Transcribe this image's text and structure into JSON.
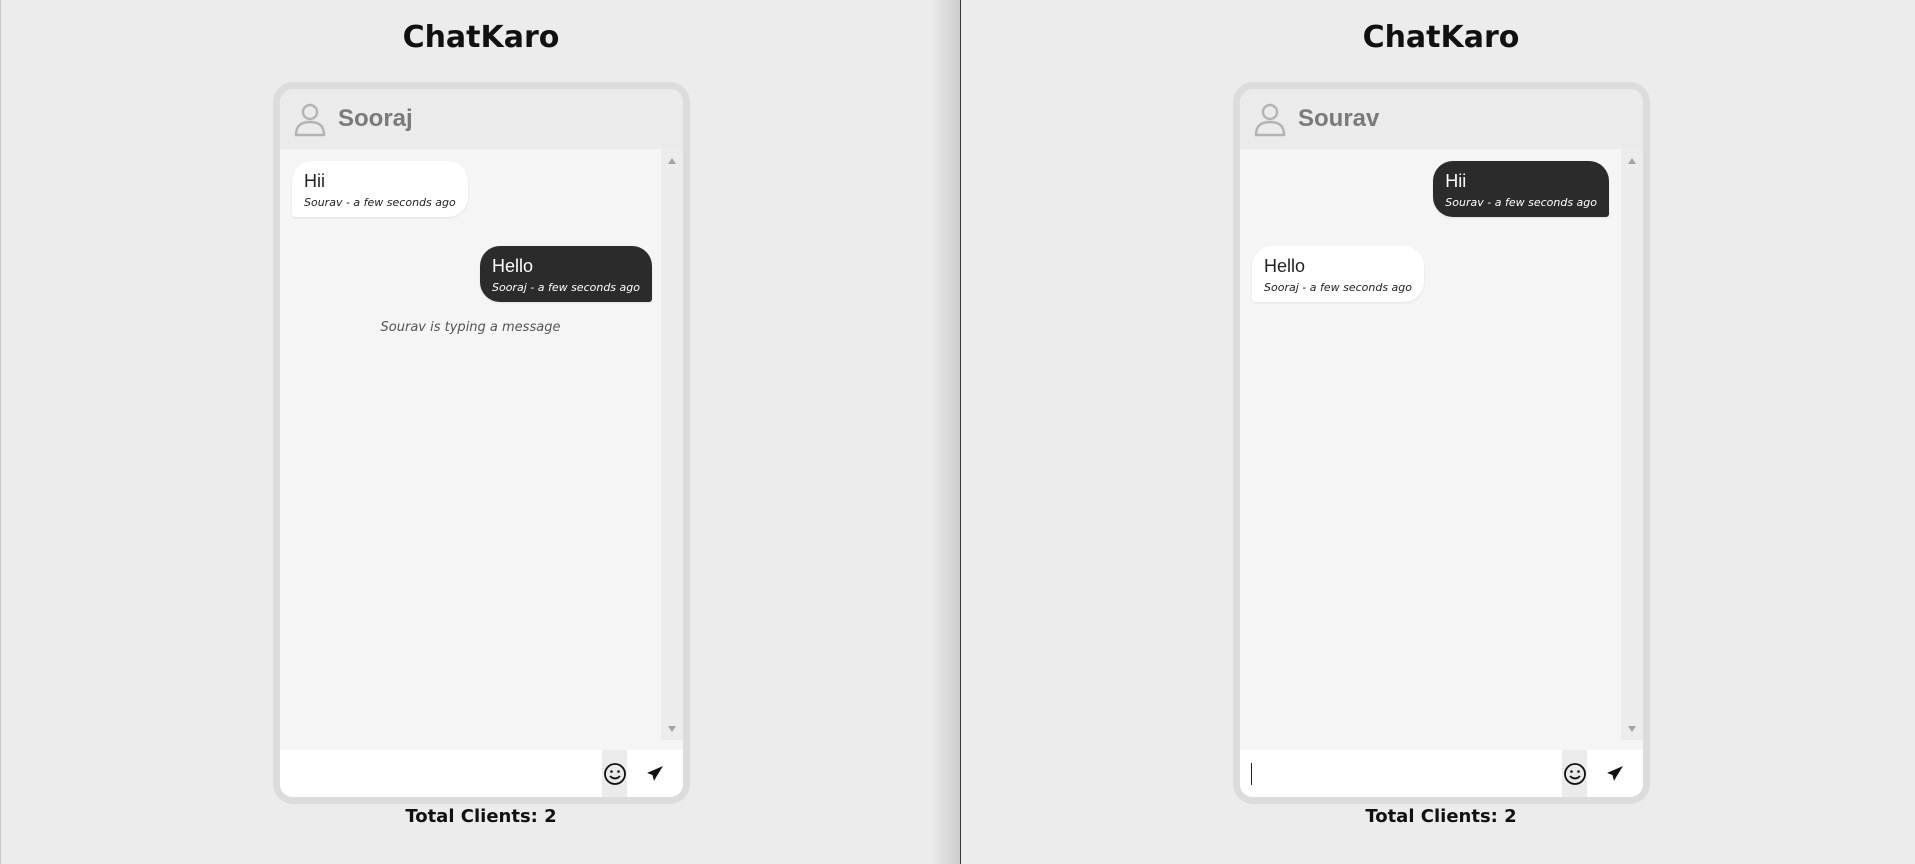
{
  "left": {
    "app_title": "ChatKaro",
    "header_name": "Sooraj",
    "messages": [
      {
        "text": "Hii",
        "meta": "Sourav - a few seconds ago",
        "side": "in"
      },
      {
        "text": "Hello",
        "meta": "Sooraj - a few seconds ago",
        "side": "out"
      }
    ],
    "typing": "Sourav is typing a message",
    "input_value": "",
    "total_clients": "Total Clients: 2"
  },
  "right": {
    "app_title": "ChatKaro",
    "header_name": "Sourav",
    "messages": [
      {
        "text": "Hii",
        "meta": "Sourav - a few seconds ago",
        "side": "out"
      },
      {
        "text": "Hello",
        "meta": "Sooraj - a few seconds ago",
        "side": "in"
      }
    ],
    "input_value": "",
    "total_clients": "Total Clients: 2"
  },
  "icons": {
    "avatar": "user-icon",
    "emoji": "smiley-icon",
    "send": "paper-plane-icon"
  },
  "colors": {
    "background": "#ececec",
    "outgoing_bubble": "#2b2b2b",
    "incoming_bubble": "#ffffff",
    "header_text": "#7a7a7a"
  }
}
